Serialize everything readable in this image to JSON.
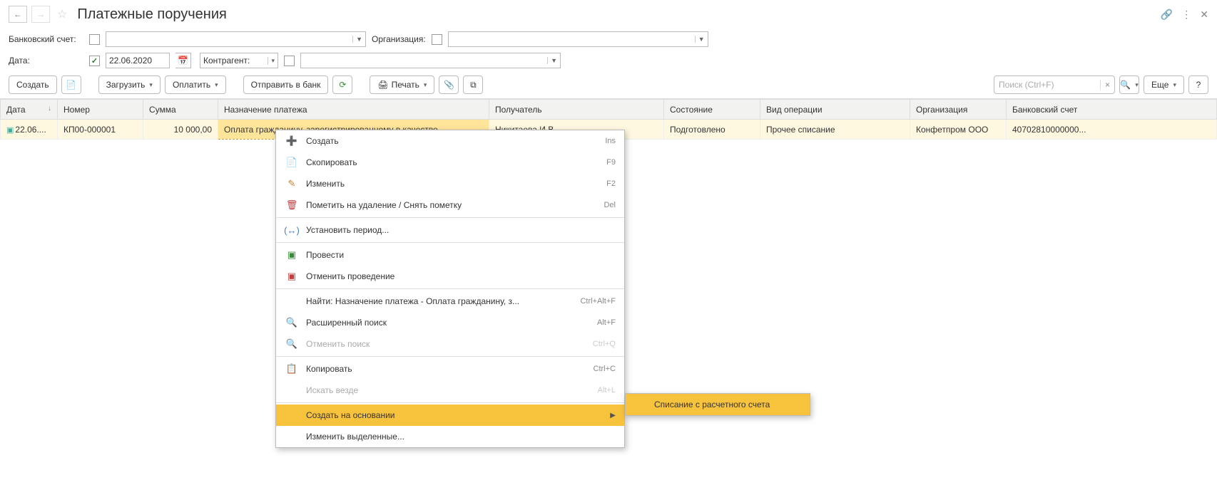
{
  "header": {
    "title": "Платежные поручения"
  },
  "filters": {
    "bank_account_label": "Банковский счет:",
    "org_label": "Организация:",
    "date_label": "Дата:",
    "date_value": "22.06.2020",
    "counterparty_label": "Контрагент:"
  },
  "toolbar": {
    "create": "Создать",
    "load": "Загрузить",
    "pay": "Оплатить",
    "send_bank": "Отправить в банк",
    "print": "Печать",
    "search_placeholder": "Поиск (Ctrl+F)",
    "more": "Еще",
    "help": "?"
  },
  "columns": {
    "date": "Дата",
    "number": "Номер",
    "sum": "Сумма",
    "purpose": "Назначение платежа",
    "recipient": "Получатель",
    "state": "Состояние",
    "op_type": "Вид операции",
    "org": "Организация",
    "bank_acc": "Банковский счет"
  },
  "row": {
    "date": "22.06....",
    "number": "КП00-000001",
    "sum": "10 000,00",
    "purpose": "Оплата гражданину, зарегистрированному в качестве...",
    "recipient": "Никитаева И.В.",
    "state": "Подготовлено",
    "op_type": "Прочее списание",
    "org": "Конфетпром ООО",
    "bank_acc": "40702810000000..."
  },
  "context_menu": {
    "create": {
      "label": "Создать",
      "shortcut": "Ins"
    },
    "copy": {
      "label": "Скопировать",
      "shortcut": "F9"
    },
    "edit": {
      "label": "Изменить",
      "shortcut": "F2"
    },
    "mark_delete": {
      "label": "Пометить на удаление / Снять пометку",
      "shortcut": "Del"
    },
    "set_period": {
      "label": "Установить период..."
    },
    "post": {
      "label": "Провести"
    },
    "unpost": {
      "label": "Отменить проведение"
    },
    "find": {
      "label": "Найти: Назначение платежа - Оплата гражданину, з...",
      "shortcut": "Ctrl+Alt+F"
    },
    "adv_search": {
      "label": "Расширенный поиск",
      "shortcut": "Alt+F"
    },
    "cancel_search": {
      "label": "Отменить поиск",
      "shortcut": "Ctrl+Q"
    },
    "copy_clip": {
      "label": "Копировать",
      "shortcut": "Ctrl+C"
    },
    "search_all": {
      "label": "Искать везде",
      "shortcut": "Alt+L"
    },
    "create_based": {
      "label": "Создать на основании"
    },
    "edit_selected": {
      "label": "Изменить выделенные..."
    }
  },
  "submenu": {
    "writeoff": "Списание с расчетного счета"
  }
}
